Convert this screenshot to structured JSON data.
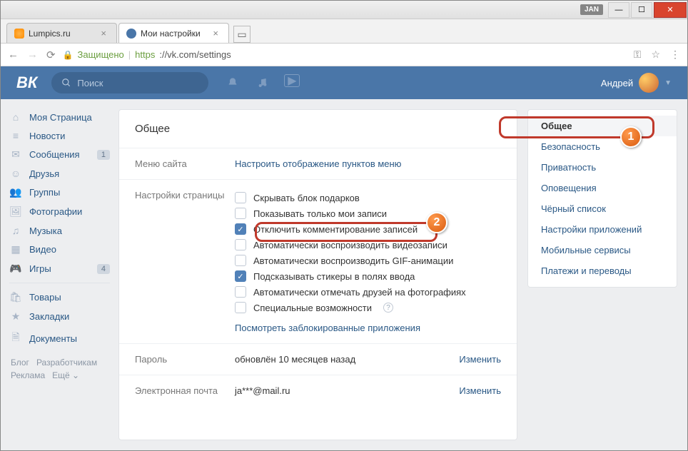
{
  "window": {
    "ext_badge": "JAN",
    "min": "—",
    "max": "☐",
    "close": "✕"
  },
  "tabs": [
    {
      "title": "Lumpics.ru",
      "active": false
    },
    {
      "title": "Мои настройки",
      "active": true
    }
  ],
  "address": {
    "back": "←",
    "fwd": "→",
    "reload": "⟳",
    "secure_label": "Защищено",
    "proto": "https",
    "url_rest": "://vk.com/settings",
    "key_icon": "⚿",
    "star_icon": "☆",
    "menu_icon": "⋮"
  },
  "vk_header": {
    "logo": "ВК",
    "search_placeholder": "Поиск",
    "username": "Андрей"
  },
  "left_nav": {
    "items": [
      {
        "icon": "⌂",
        "label": "Моя Страница"
      },
      {
        "icon": "≡",
        "label": "Новости"
      },
      {
        "icon": "✉",
        "label": "Сообщения",
        "badge": "1"
      },
      {
        "icon": "☺",
        "label": "Друзья"
      },
      {
        "icon": "👥",
        "label": "Группы"
      },
      {
        "icon": "🖼",
        "label": "Фотографии"
      },
      {
        "icon": "♫",
        "label": "Музыка"
      },
      {
        "icon": "▦",
        "label": "Видео"
      },
      {
        "icon": "🎮",
        "label": "Игры",
        "badge": "4"
      }
    ],
    "items2": [
      {
        "icon": "🛍",
        "label": "Товары"
      },
      {
        "icon": "★",
        "label": "Закладки"
      },
      {
        "icon": "🗎",
        "label": "Документы"
      }
    ],
    "footer": [
      "Блог",
      "Разработчикам",
      "Реклама",
      "Ещё ⌄"
    ]
  },
  "settings": {
    "title": "Общее",
    "menu_section_label": "Меню сайта",
    "menu_section_link": "Настроить отображение пунктов меню",
    "page_section_label": "Настройки страницы",
    "checks": [
      {
        "label": "Скрывать блок подарков",
        "checked": false
      },
      {
        "label": "Показывать только мои записи",
        "checked": false
      },
      {
        "label": "Отключить комментирование записей",
        "checked": true
      },
      {
        "label": "Автоматически воспроизводить видеозаписи",
        "checked": false
      },
      {
        "label": "Автоматически воспроизводить GIF-анимации",
        "checked": false
      },
      {
        "label": "Подсказывать стикеры в полях ввода",
        "checked": true
      },
      {
        "label": "Автоматически отмечать друзей на фотографиях",
        "checked": false
      },
      {
        "label": "Специальные возможности",
        "checked": false,
        "help": true
      }
    ],
    "blocked_apps_link": "Посмотреть заблокированные приложения",
    "password_label": "Пароль",
    "password_value": "обновлён 10 месяцев назад",
    "email_label": "Электронная почта",
    "email_value": "ja***@mail.ru",
    "change_link": "Изменить"
  },
  "right_menu": [
    "Общее",
    "Безопасность",
    "Приватность",
    "Оповещения",
    "Чёрный список",
    "Настройки приложений",
    "Мобильные сервисы",
    "Платежи и переводы"
  ],
  "annotations": {
    "n1": "1",
    "n2": "2"
  }
}
